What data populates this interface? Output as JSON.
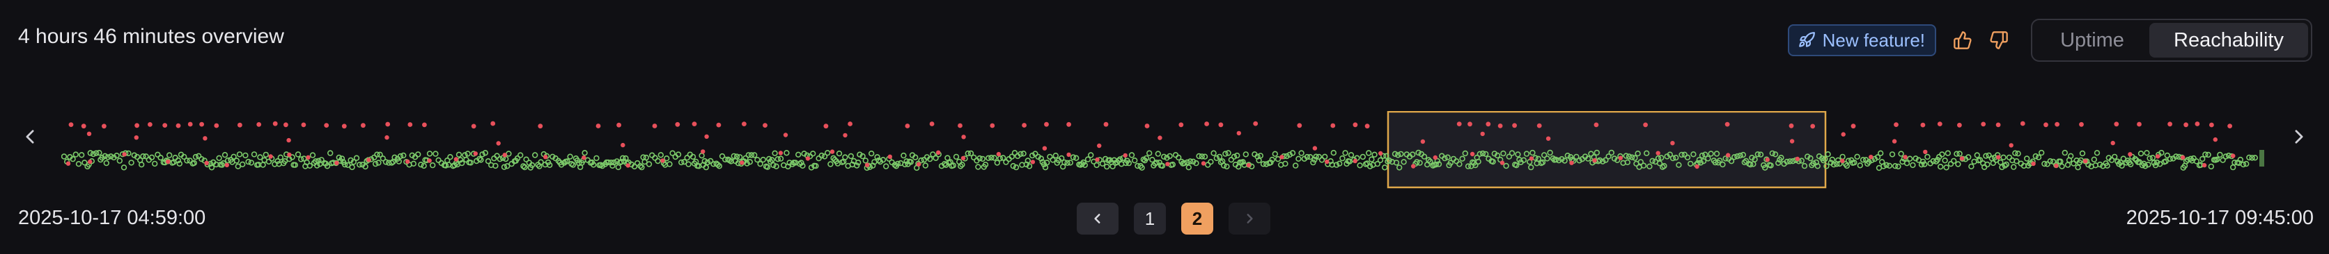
{
  "header": {
    "title": "4 hours 46 minutes overview",
    "new_feature_label": "New feature!"
  },
  "view_toggle": {
    "uptime_label": "Uptime",
    "reachability_label": "Reachability",
    "selected": "Reachability"
  },
  "timeline": {
    "start_label": "2025-10-17 04:59:00",
    "end_label": "2025-10-17 09:45:00",
    "selection_window": {
      "from_fraction": 0.6015,
      "to_fraction": 0.7997
    },
    "status_colors": {
      "up": "#7ccb6a",
      "down": "#e8505b",
      "selection_border": "#e0a84a"
    }
  },
  "pagination": {
    "pages": [
      "1",
      "2"
    ],
    "current_page": "2",
    "prev_icon": "chevron-left-icon",
    "next_icon": "chevron-right-icon"
  },
  "colors": {
    "accent": "#f0a060",
    "background": "#101014",
    "feature_badge": "#9cc0ff"
  }
}
